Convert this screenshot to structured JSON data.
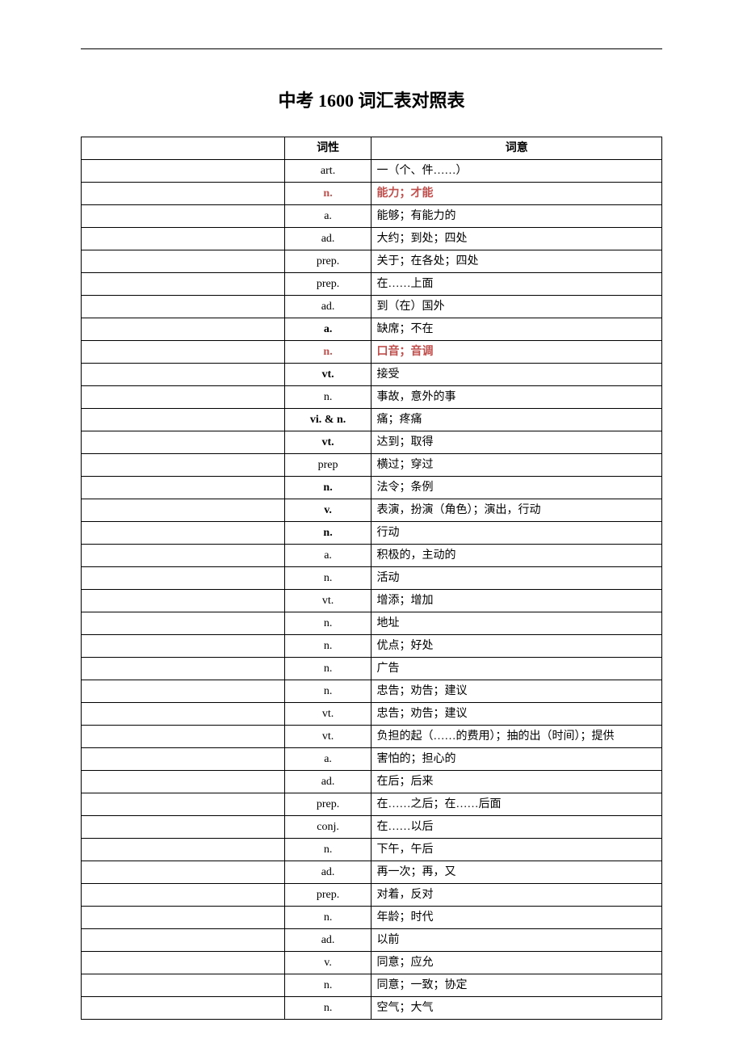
{
  "title": "中考 1600 词汇表对照表",
  "headers": {
    "pos": "词性",
    "meaning": "词意"
  },
  "rows": [
    {
      "pos": "art.",
      "meaning": "一（个、件……）"
    },
    {
      "pos": "n.",
      "meaning": "能力；才能",
      "posRed": true,
      "posBold": true,
      "meanRed": true,
      "meanBold": true
    },
    {
      "pos": "a.",
      "meaning": "能够；有能力的"
    },
    {
      "pos": "ad.",
      "meaning": "大约；到处；四处"
    },
    {
      "pos": "prep.",
      "meaning": "关于；在各处；四处"
    },
    {
      "pos": "prep.",
      "meaning": "在……上面"
    },
    {
      "pos": "ad.",
      "meaning": "到（在）国外"
    },
    {
      "pos": "a.",
      "meaning": "缺席；不在",
      "posBold": true
    },
    {
      "pos": "n.",
      "meaning": "口音；音调",
      "posRed": true,
      "posBold": true,
      "meanRed": true,
      "meanBold": true
    },
    {
      "pos": "vt.",
      "meaning": "接受",
      "posBold": true
    },
    {
      "pos": "n.",
      "meaning": "事故，意外的事"
    },
    {
      "pos": "vi. & n.",
      "meaning": "痛；疼痛",
      "posBold": true
    },
    {
      "pos": "vt.",
      "meaning": "达到；取得",
      "posBold": true
    },
    {
      "pos": "prep",
      "meaning": "横过；穿过"
    },
    {
      "pos": "n.",
      "meaning": "法令；条例",
      "posBold": true
    },
    {
      "pos": "v.",
      "meaning": "表演，扮演（角色）；演出，行动",
      "posBold": true
    },
    {
      "pos": "n.",
      "meaning": "行动",
      "posBold": true
    },
    {
      "pos": "a.",
      "meaning": "积极的，主动的"
    },
    {
      "pos": "n.",
      "meaning": "活动"
    },
    {
      "pos": "vt.",
      "meaning": "增添；增加"
    },
    {
      "pos": "n.",
      "meaning": "地址"
    },
    {
      "pos": "n.",
      "meaning": "优点；好处"
    },
    {
      "pos": "n.",
      "meaning": "广告"
    },
    {
      "pos": "n.",
      "meaning": "忠告；劝告；建议"
    },
    {
      "pos": "vt.",
      "meaning": "忠告；劝告；建议"
    },
    {
      "pos": "vt.",
      "meaning": "负担的起（……的费用）；抽的出（时间）；提供"
    },
    {
      "pos": "a.",
      "meaning": "害怕的；担心的"
    },
    {
      "pos": "ad.",
      "meaning": "在后；后来"
    },
    {
      "pos": "prep.",
      "meaning": "在……之后；在……后面"
    },
    {
      "pos": "conj.",
      "meaning": "在……以后"
    },
    {
      "pos": "n.",
      "meaning": "下午，午后"
    },
    {
      "pos": "ad.",
      "meaning": "再一次；再，又"
    },
    {
      "pos": "prep.",
      "meaning": "对着，反对"
    },
    {
      "pos": "n.",
      "meaning": "年龄；时代"
    },
    {
      "pos": "ad.",
      "meaning": "以前"
    },
    {
      "pos": "v.",
      "meaning": "同意；应允"
    },
    {
      "pos": "n.",
      "meaning": "同意；一致；协定"
    },
    {
      "pos": "n.",
      "meaning": "空气；大气"
    }
  ]
}
